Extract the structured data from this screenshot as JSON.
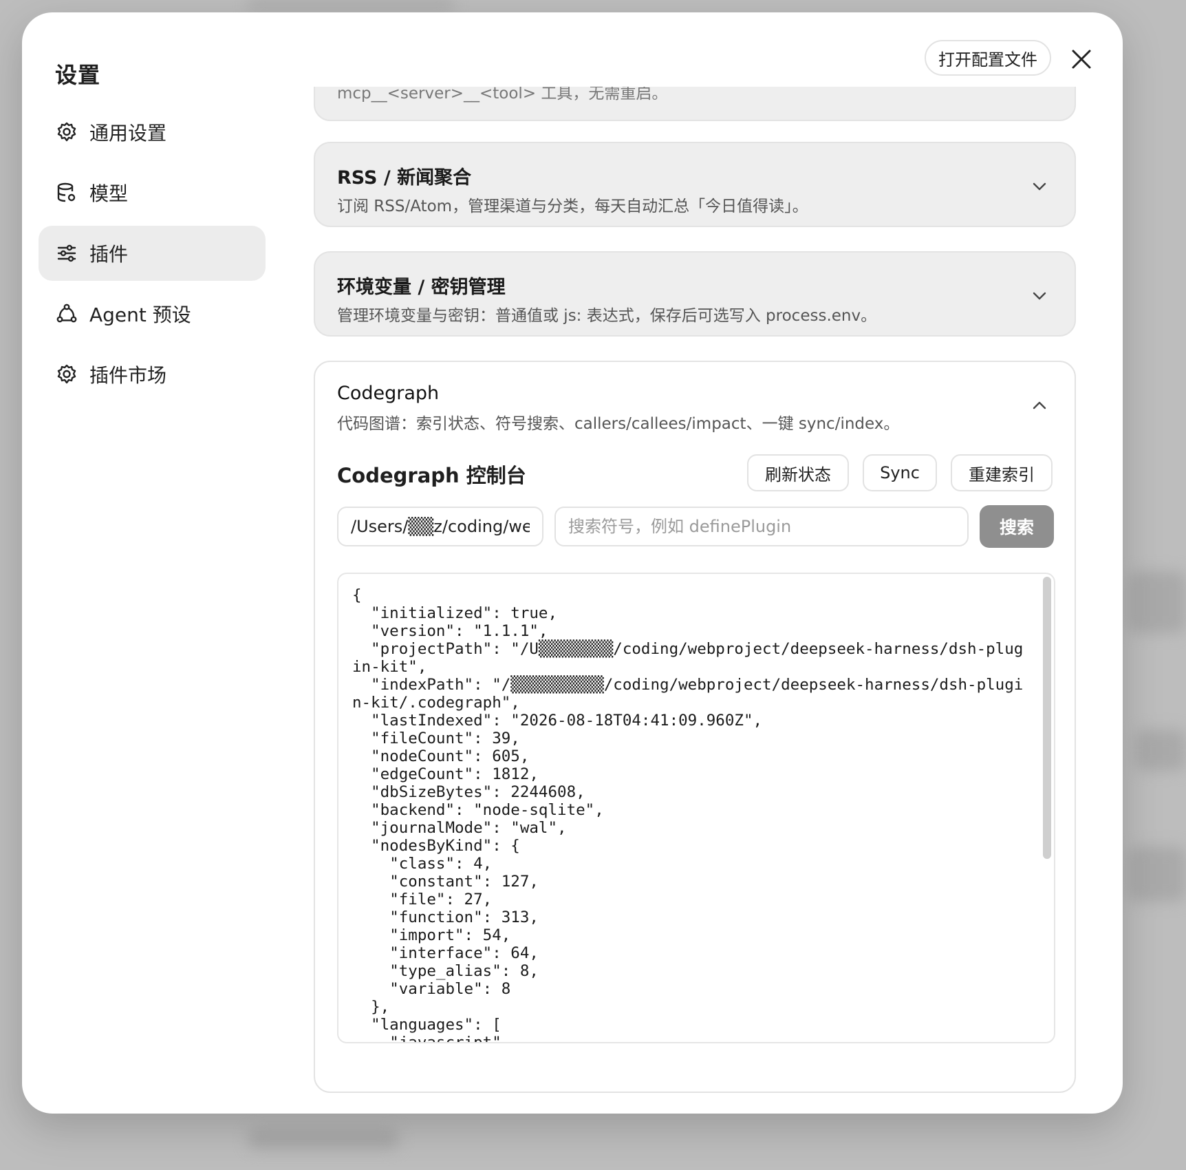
{
  "modal": {
    "title": "设置",
    "open_config_label": "打开配置文件"
  },
  "sidebar": {
    "items": [
      {
        "label": "通用设置",
        "icon": "gear-icon"
      },
      {
        "label": "模型",
        "icon": "database-gear-icon"
      },
      {
        "label": "插件",
        "icon": "sliders-icon",
        "active": true
      },
      {
        "label": "Agent 预设",
        "icon": "agent-network-icon"
      },
      {
        "label": "插件市场",
        "icon": "gear-icon"
      }
    ]
  },
  "plugins": {
    "partial_card_desc": "mcp__<server>__<tool> 工具，无需重启。",
    "cards": [
      {
        "title": "RSS / 新闻聚合",
        "desc": "订阅 RSS/Atom，管理渠道与分类，每天自动汇总「今日值得读」。"
      },
      {
        "title": "环境变量 / 密钥管理",
        "desc": "管理环境变量与密钥：普通值或 js: 表达式，保存后可选写入 process.env。"
      }
    ],
    "codegraph": {
      "title": "Codegraph",
      "desc": "代码图谱：索引状态、符号搜索、callers/callees/impact、一键 sync/index。",
      "console_title": "Codegraph 控制台",
      "refresh_label": "刷新状态",
      "sync_label": "Sync",
      "rebuild_label": "重建索引",
      "path_value": "/Users/▒▒z/coding/we",
      "search_placeholder": "搜索符号，例如 definePlugin",
      "search_label": "搜索",
      "json_output": "{\n  \"initialized\": true,\n  \"version\": \"1.1.1\",\n  \"projectPath\": \"/U▒▒▒▒▒▒▒▒/coding/webproject/deepseek-harness/dsh-plugin-kit\",\n  \"indexPath\": \"/▒▒▒▒▒▒▒▒▒▒/coding/webproject/deepseek-harness/dsh-plugin-kit/.codegraph\",\n  \"lastIndexed\": \"2026-08-18T04:41:09.960Z\",\n  \"fileCount\": 39,\n  \"nodeCount\": 605,\n  \"edgeCount\": 1812,\n  \"dbSizeBytes\": 2244608,\n  \"backend\": \"node-sqlite\",\n  \"journalMode\": \"wal\",\n  \"nodesByKind\": {\n    \"class\": 4,\n    \"constant\": 127,\n    \"file\": 27,\n    \"function\": 313,\n    \"import\": 54,\n    \"interface\": 64,\n    \"type_alias\": 8,\n    \"variable\": 8\n  },\n  \"languages\": [\n    \"javascript\""
    }
  }
}
